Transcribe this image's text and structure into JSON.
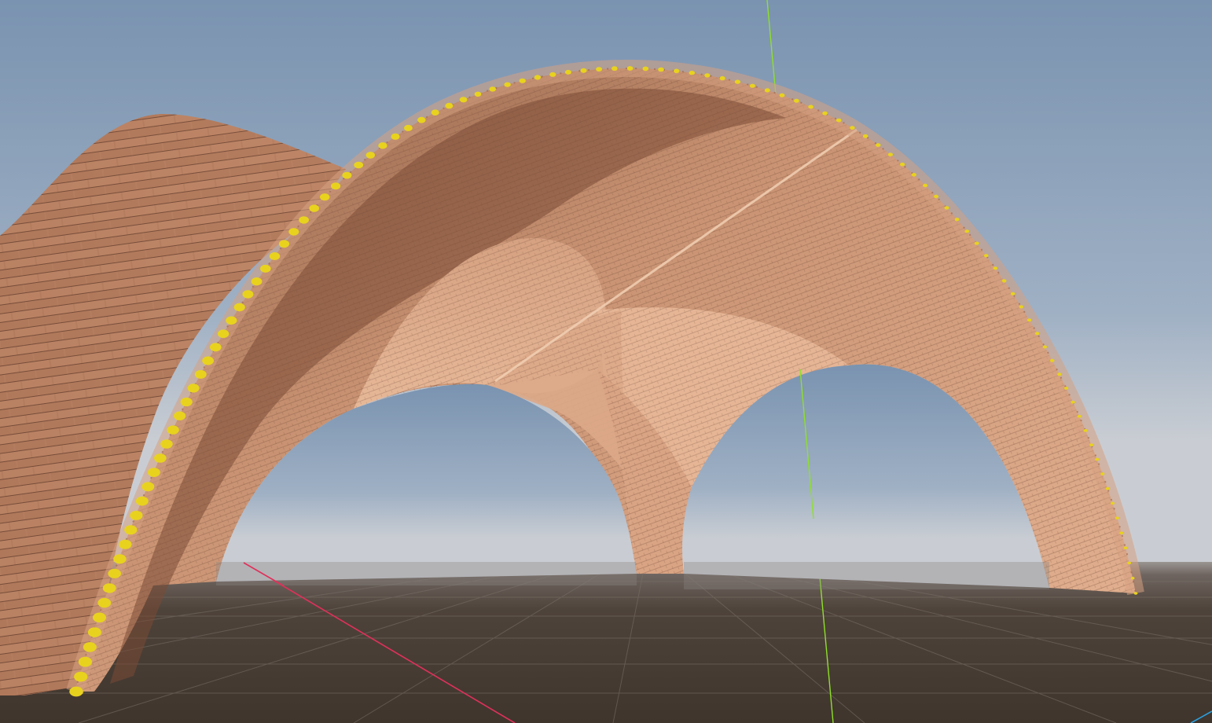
{
  "app": {
    "view": "3d-viewport"
  },
  "scene": {
    "sky_top_color": "#7a93b0",
    "sky_horizon_color": "#c9cdd3",
    "ground_color": "#4a3f35",
    "brick_light_color": "#e2b08f",
    "brick_mid_color": "#c98f6d",
    "brick_dark_color": "#6b4634",
    "mortar_color": "#f0c8a8",
    "control_point_color": "#e8d21e",
    "axes": {
      "x_color": "#e0305a",
      "y_color": "#8ee02a",
      "z_color": "#2aa0e0"
    },
    "objects": [
      "groin-vault",
      "barrel-arch",
      "control-points",
      "ground-grid",
      "world-axes"
    ]
  }
}
